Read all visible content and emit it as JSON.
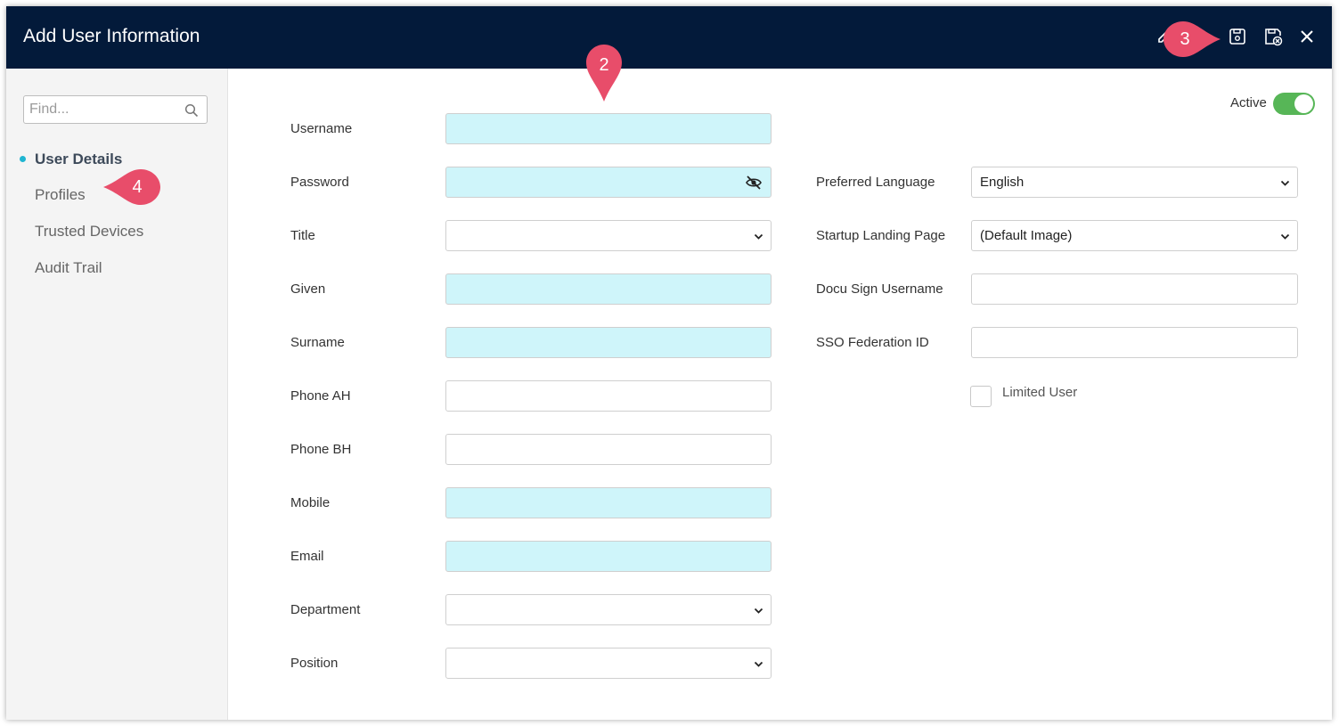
{
  "header": {
    "title": "Add User Information"
  },
  "sidebar": {
    "search_placeholder": "Find...",
    "items": [
      {
        "label": "User Details",
        "active": true
      },
      {
        "label": "Profiles"
      },
      {
        "label": "Trusted Devices"
      },
      {
        "label": "Audit Trail"
      }
    ]
  },
  "form": {
    "left": [
      {
        "label": "Username",
        "type": "text",
        "required": true,
        "value": ""
      },
      {
        "label": "Password",
        "type": "password",
        "required": true,
        "value": ""
      },
      {
        "label": "Title",
        "type": "select",
        "value": ""
      },
      {
        "label": "Given",
        "type": "text",
        "required": true,
        "value": ""
      },
      {
        "label": "Surname",
        "type": "text",
        "required": true,
        "value": ""
      },
      {
        "label": "Phone AH",
        "type": "text",
        "value": ""
      },
      {
        "label": "Phone BH",
        "type": "text",
        "value": ""
      },
      {
        "label": "Mobile",
        "type": "text",
        "required": true,
        "value": ""
      },
      {
        "label": "Email",
        "type": "text",
        "required": true,
        "value": ""
      },
      {
        "label": "Department",
        "type": "select",
        "value": ""
      },
      {
        "label": "Position",
        "type": "select",
        "value": ""
      }
    ],
    "right": [
      {
        "label": "Preferred Language",
        "type": "select",
        "value": "English"
      },
      {
        "label": "Startup Landing Page",
        "type": "select",
        "value": "(Default Image)"
      },
      {
        "label": "Docu Sign Username",
        "type": "text",
        "value": ""
      },
      {
        "label": "SSO Federation ID",
        "type": "text",
        "value": ""
      }
    ],
    "limited_user_label": "Limited User",
    "limited_user_checked": false,
    "active_label": "Active",
    "active_on": true
  },
  "callouts": [
    "2",
    "3",
    "4"
  ],
  "colors": {
    "header_bg": "#031a3a",
    "required_bg": "#cff5fa",
    "toggle_on": "#57b657",
    "callout": "#e84d6a",
    "active_dot": "#1fb5d1"
  },
  "icons": {
    "header": [
      "edit-icon",
      "save-icon",
      "save-close-icon",
      "close-icon"
    ],
    "search": "search-icon",
    "password": "eye-slash-icon"
  }
}
